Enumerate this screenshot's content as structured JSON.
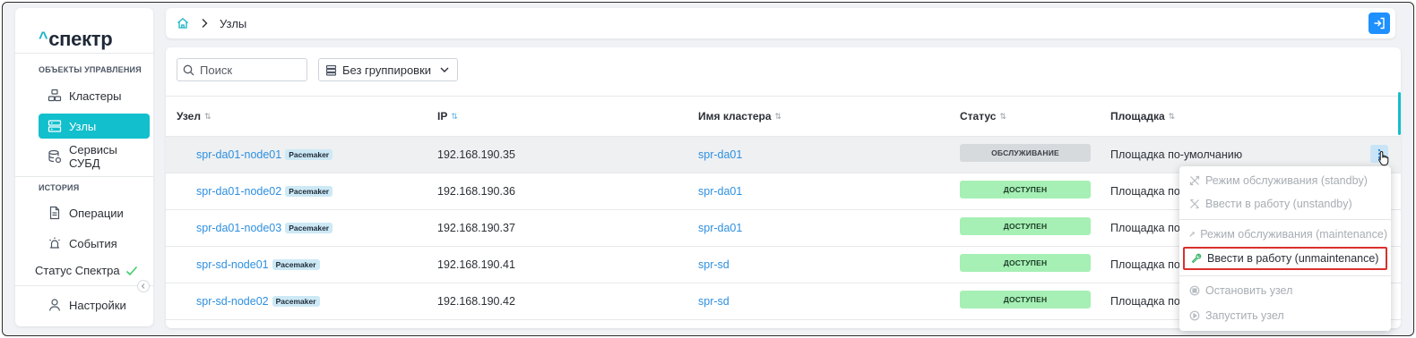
{
  "sidebar": {
    "logo": "спектр",
    "logo_caret": "^",
    "section_objects": "Объекты управления",
    "section_history": "История",
    "items": [
      {
        "label": "Кластеры"
      },
      {
        "label": "Узлы"
      },
      {
        "label": "Сервисы СУБД"
      },
      {
        "label": "Операции"
      },
      {
        "label": "События"
      }
    ],
    "status_label": "Статус Спектра",
    "settings_label": "Настройки",
    "accent_color": "#12bfcc"
  },
  "header": {
    "breadcrumb_current": "Узлы"
  },
  "toolbar": {
    "search_placeholder": "Поиск",
    "grouping_value": "Без группировки"
  },
  "table": {
    "columns": [
      {
        "label": "Узел",
        "sort": "⇅"
      },
      {
        "label": "IP",
        "sort": "⇅"
      },
      {
        "label": "Имя кластера",
        "sort": "⇅"
      },
      {
        "label": "Статус",
        "sort": "⇅"
      },
      {
        "label": "Площадка",
        "sort": "⇅"
      }
    ],
    "rows": [
      {
        "node": "spr-da01-node01",
        "badge": "Pacemaker",
        "ip": "192.168.190.35",
        "cluster": "spr-da01",
        "status": "ОБСЛУЖИВАНИЕ",
        "site": "Площадка по-умолчанию"
      },
      {
        "node": "spr-da01-node02",
        "badge": "Pacemaker",
        "ip": "192.168.190.36",
        "cluster": "spr-da01",
        "status": "ДОСТУПЕН",
        "site": "Площадка по-у"
      },
      {
        "node": "spr-da01-node03",
        "badge": "Pacemaker",
        "ip": "192.168.190.37",
        "cluster": "spr-da01",
        "status": "ДОСТУПЕН",
        "site": "Площадка по-у"
      },
      {
        "node": "spr-sd-node01",
        "badge": "Pacemaker",
        "ip": "192.168.190.41",
        "cluster": "spr-sd",
        "status": "ДОСТУПЕН",
        "site": "Площадка по-у"
      },
      {
        "node": "spr-sd-node02",
        "badge": "Pacemaker",
        "ip": "192.168.190.42",
        "cluster": "spr-sd",
        "status": "ДОСТУПЕН",
        "site": "Площадка по-у"
      }
    ]
  },
  "menu": {
    "items": [
      {
        "label": "Режим обслуживания (standby)"
      },
      {
        "label": "Ввести в работу (unstandby)"
      },
      {
        "label": "Режим обслуживания (maintenance)"
      },
      {
        "label": "Ввести в работу (unmaintenance)"
      },
      {
        "label": "Остановить узел"
      },
      {
        "label": "Запустить узел"
      }
    ]
  },
  "colors": {
    "link": "#2d8fe0",
    "status_ok": "#a6f0b5",
    "status_maintenance": "#d7dadd",
    "highlight_border": "#d9302c",
    "primary_button": "#1e90ff"
  }
}
